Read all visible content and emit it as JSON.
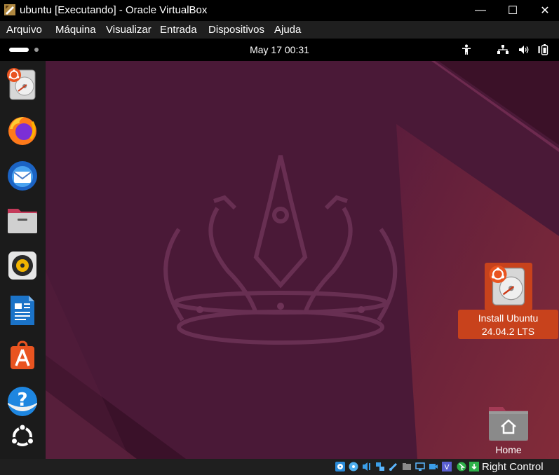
{
  "window": {
    "title": "ubuntu [Executando] - Oracle VirtualBox",
    "minimize": "—",
    "maximize": "☐",
    "close": "✕"
  },
  "menu": [
    "Arquivo",
    "Máquina",
    "Visualizar",
    "Entrada",
    "Dispositivos",
    "Ajuda"
  ],
  "topbar": {
    "clock": "May 17  00:31",
    "icons": [
      "accessibility-icon",
      "network-icon",
      "volume-icon",
      "battery-icon"
    ]
  },
  "dock": [
    "ubuntu-installer",
    "firefox",
    "thunderbird",
    "files",
    "rhythmbox",
    "libreoffice-writer",
    "app-center",
    "help",
    "show-apps"
  ],
  "desktop": {
    "install_label_line1": "Install Ubuntu",
    "install_label_line2": "24.04.2 LTS",
    "home_label": "Home"
  },
  "statusbar": {
    "host_key": "Right Control"
  },
  "colors": {
    "accent": "#e95420",
    "background": "#4d1a3a",
    "panel": "#000000"
  }
}
